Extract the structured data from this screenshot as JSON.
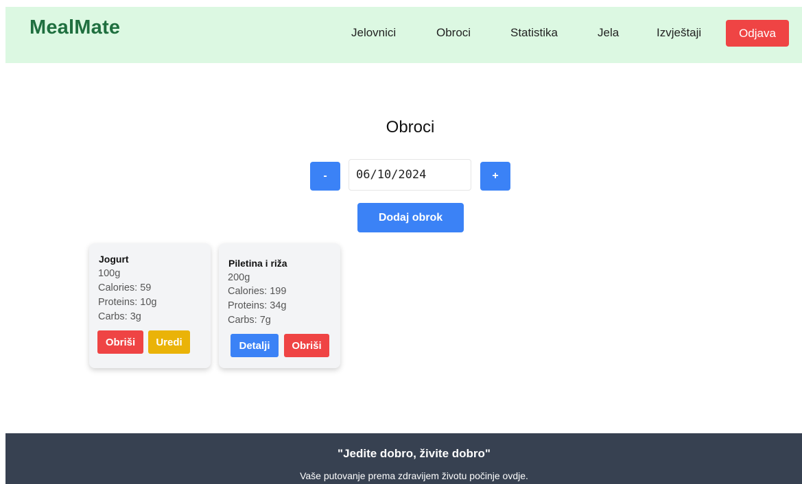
{
  "header": {
    "logo": "MealMate",
    "nav": [
      {
        "label": "Jelovnici"
      },
      {
        "label": "Obroci"
      },
      {
        "label": "Statistika"
      },
      {
        "label": "Jela"
      },
      {
        "label": "Izvještaji"
      }
    ],
    "logout_label": "Odjava"
  },
  "main": {
    "title": "Obroci",
    "date_value": "06/10/2024",
    "decrement_label": "-",
    "increment_label": "+",
    "add_meal_label": "Dodaj obrok"
  },
  "meals": [
    {
      "name": "Jogurt",
      "amount": "100g",
      "calories": "Calories: 59",
      "proteins": "Proteins: 10g",
      "carbs": "Carbs: 3g",
      "buttons": [
        "Obriši",
        "Uredi"
      ]
    },
    {
      "name": "Piletina i riža",
      "amount": "200g",
      "calories": "Calories: 199",
      "proteins": "Proteins: 34g",
      "carbs": "Carbs: 7g",
      "buttons": [
        "Detalji",
        "Obriši"
      ]
    }
  ],
  "footer": {
    "quote": "\"Jedite dobro, živite dobro\"",
    "subtitle": "Vaše putovanje prema zdravijem životu počinje ovdje."
  },
  "colors": {
    "header_bg": "#dcf8e2",
    "logo": "#1f6f3f",
    "primary": "#3b82f6",
    "danger": "#ef4444",
    "warning": "#eab308",
    "footer_bg": "#374151"
  }
}
